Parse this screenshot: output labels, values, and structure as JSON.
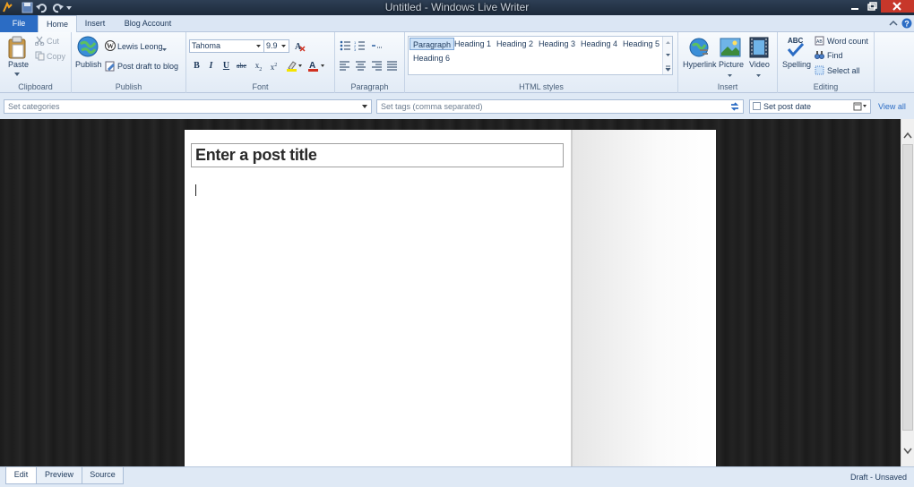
{
  "window": {
    "title": "Untitled - Windows Live Writer",
    "controls": [
      "minimize",
      "restore",
      "close"
    ]
  },
  "tabs": [
    "File",
    "Home",
    "Insert",
    "Blog Account"
  ],
  "ribbon": {
    "clipboard": {
      "label": "Clipboard",
      "paste": "Paste",
      "cut": "Cut",
      "copy": "Copy"
    },
    "publish": {
      "label": "Publish",
      "publish_button": "Publish",
      "account": "Lewis Leong",
      "draft": "Post draft to blog"
    },
    "font": {
      "label": "Font",
      "family": "Tahoma",
      "size": "9.9"
    },
    "paragraph": {
      "label": "Paragraph"
    },
    "html_styles": {
      "label": "HTML styles",
      "items": [
        "Paragraph",
        "Heading 1",
        "Heading 2",
        "Heading 3",
        "Heading 4",
        "Heading 5",
        "Heading 6"
      ],
      "selected": "Paragraph"
    },
    "insert": {
      "label": "Insert",
      "hyperlink": "Hyperlink",
      "picture": "Picture",
      "video": "Video"
    },
    "editing": {
      "label": "Editing",
      "spelling": "Spelling",
      "word_count": "Word count",
      "find": "Find",
      "select_all": "Select all"
    }
  },
  "settings": {
    "categories_placeholder": "Set categories",
    "tags_placeholder": "Set tags (comma separated)",
    "post_date": "Set post date",
    "view_all": "View all"
  },
  "editor": {
    "title_placeholder": "Enter a post title"
  },
  "view_tabs": [
    "Edit",
    "Preview",
    "Source"
  ],
  "status": "Draft - Unsaved",
  "colors": {
    "accent": "#2b6cc4",
    "highlight": "#f5e400",
    "font_color": "#d03020"
  }
}
